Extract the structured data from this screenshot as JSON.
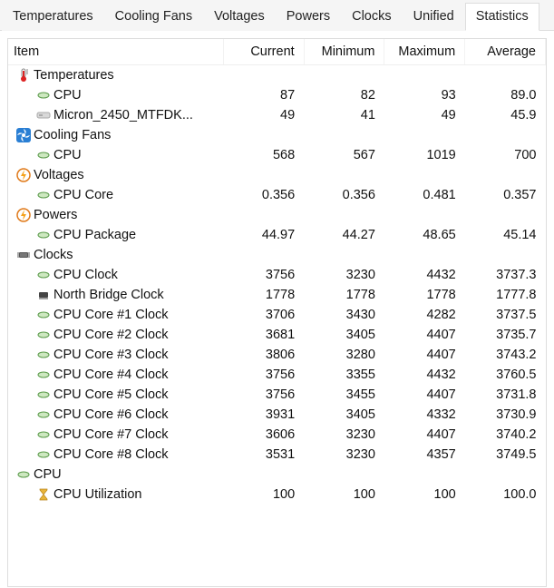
{
  "tabs": [
    {
      "label": "Temperatures",
      "active": false
    },
    {
      "label": "Cooling Fans",
      "active": false
    },
    {
      "label": "Voltages",
      "active": false
    },
    {
      "label": "Powers",
      "active": false
    },
    {
      "label": "Clocks",
      "active": false
    },
    {
      "label": "Unified",
      "active": false
    },
    {
      "label": "Statistics",
      "active": true
    }
  ],
  "columns": [
    "Item",
    "Current",
    "Minimum",
    "Maximum",
    "Average"
  ],
  "rows": [
    {
      "type": "group",
      "icon": "thermometer",
      "label": "Temperatures"
    },
    {
      "type": "item",
      "icon": "sensor",
      "label": "CPU",
      "current": "87",
      "minimum": "82",
      "maximum": "93",
      "average": "89.0"
    },
    {
      "type": "item",
      "icon": "ssd",
      "label": "Micron_2450_MTFDK...",
      "current": "49",
      "minimum": "41",
      "maximum": "49",
      "average": "45.9"
    },
    {
      "type": "group",
      "icon": "fan",
      "label": "Cooling Fans"
    },
    {
      "type": "item",
      "icon": "sensor",
      "label": "CPU",
      "current": "568",
      "minimum": "567",
      "maximum": "1019",
      "average": "700"
    },
    {
      "type": "group",
      "icon": "bolt",
      "label": "Voltages"
    },
    {
      "type": "item",
      "icon": "sensor",
      "label": "CPU Core",
      "current": "0.356",
      "minimum": "0.356",
      "maximum": "0.481",
      "average": "0.357"
    },
    {
      "type": "group",
      "icon": "bolt",
      "label": "Powers"
    },
    {
      "type": "item",
      "icon": "sensor",
      "label": "CPU Package",
      "current": "44.97",
      "minimum": "44.27",
      "maximum": "48.65",
      "average": "45.14"
    },
    {
      "type": "group",
      "icon": "chip",
      "label": "Clocks"
    },
    {
      "type": "item",
      "icon": "sensor",
      "label": "CPU Clock",
      "current": "3756",
      "minimum": "3230",
      "maximum": "4432",
      "average": "3737.3"
    },
    {
      "type": "item",
      "icon": "chip-sm",
      "label": "North Bridge Clock",
      "current": "1778",
      "minimum": "1778",
      "maximum": "1778",
      "average": "1777.8"
    },
    {
      "type": "item",
      "icon": "sensor",
      "label": "CPU Core #1 Clock",
      "current": "3706",
      "minimum": "3430",
      "maximum": "4282",
      "average": "3737.5"
    },
    {
      "type": "item",
      "icon": "sensor",
      "label": "CPU Core #2 Clock",
      "current": "3681",
      "minimum": "3405",
      "maximum": "4407",
      "average": "3735.7"
    },
    {
      "type": "item",
      "icon": "sensor",
      "label": "CPU Core #3 Clock",
      "current": "3806",
      "minimum": "3280",
      "maximum": "4407",
      "average": "3743.2"
    },
    {
      "type": "item",
      "icon": "sensor",
      "label": "CPU Core #4 Clock",
      "current": "3756",
      "minimum": "3355",
      "maximum": "4432",
      "average": "3760.5"
    },
    {
      "type": "item",
      "icon": "sensor",
      "label": "CPU Core #5 Clock",
      "current": "3756",
      "minimum": "3455",
      "maximum": "4407",
      "average": "3731.8"
    },
    {
      "type": "item",
      "icon": "sensor",
      "label": "CPU Core #6 Clock",
      "current": "3931",
      "minimum": "3405",
      "maximum": "4332",
      "average": "3730.9"
    },
    {
      "type": "item",
      "icon": "sensor",
      "label": "CPU Core #7 Clock",
      "current": "3606",
      "minimum": "3230",
      "maximum": "4407",
      "average": "3740.2"
    },
    {
      "type": "item",
      "icon": "sensor",
      "label": "CPU Core #8 Clock",
      "current": "3531",
      "minimum": "3230",
      "maximum": "4357",
      "average": "3749.5"
    },
    {
      "type": "group",
      "icon": "sensor",
      "label": "CPU"
    },
    {
      "type": "item",
      "icon": "hourglass",
      "label": "CPU Utilization",
      "current": "100",
      "minimum": "100",
      "maximum": "100",
      "average": "100.0"
    }
  ]
}
